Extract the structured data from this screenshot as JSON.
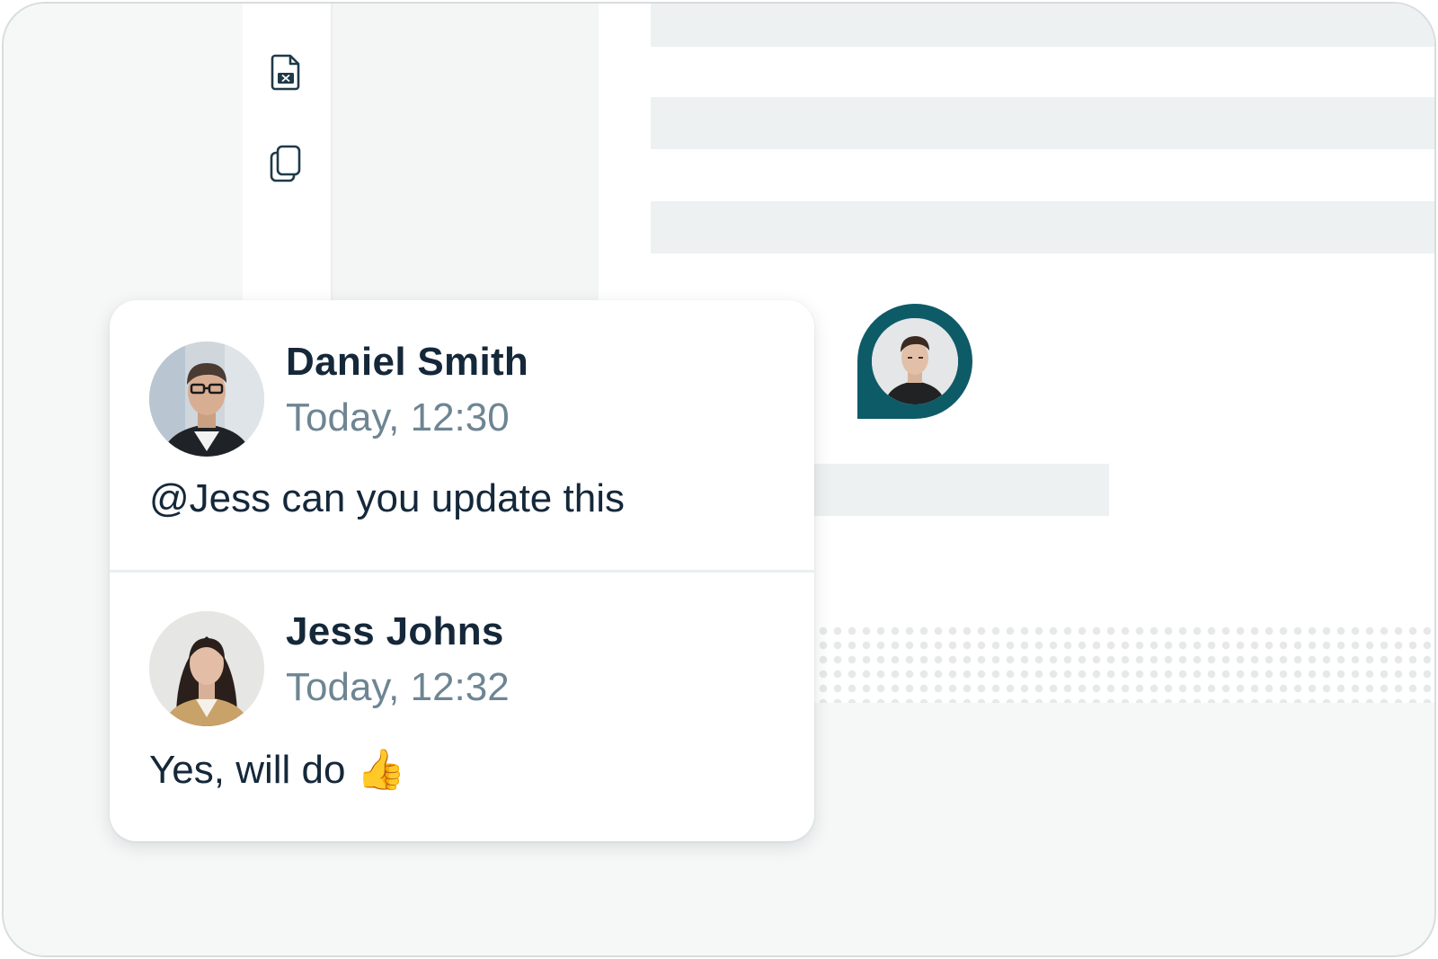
{
  "toolbar": {
    "icons": [
      "file-x-icon",
      "copy-icon"
    ]
  },
  "presence": {
    "avatar": "avatar-man-dark-shirt"
  },
  "comments": [
    {
      "author": "Daniel Smith",
      "time": "Today, 12:30",
      "message": "@Jess can you update this",
      "avatar": "avatar-man-glasses"
    },
    {
      "author": "Jess Johns",
      "time": "Today, 12:32",
      "message": "Yes, will do 👍",
      "avatar": "avatar-woman-dark-hair"
    }
  ],
  "colors": {
    "accent": "#0e5b68",
    "text_primary": "#15283a",
    "text_secondary": "#6e8593",
    "background": "#f6f7f7"
  }
}
